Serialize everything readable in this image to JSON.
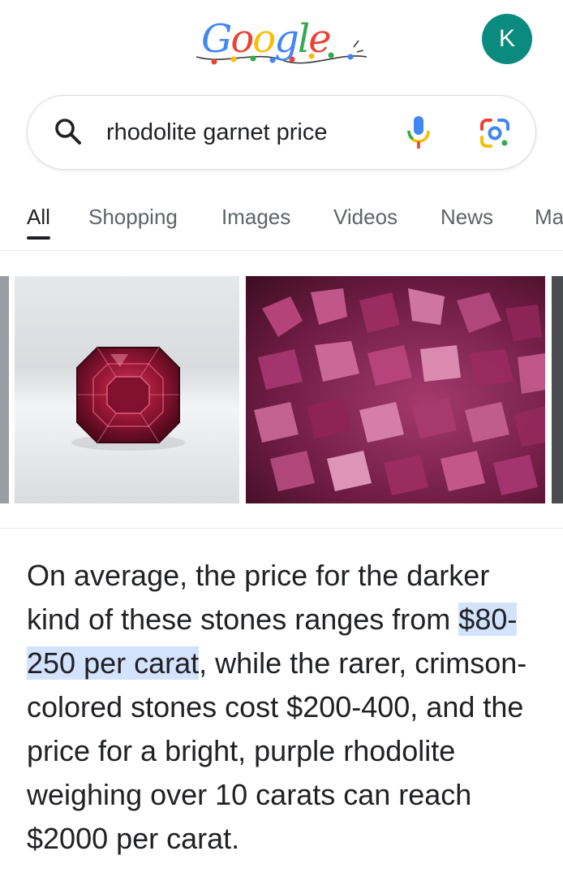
{
  "logo": {
    "text": "Google",
    "letters": [
      "G",
      "o",
      "o",
      "g",
      "l",
      "e"
    ]
  },
  "account": {
    "initial": "K",
    "color": "#0b8a7f"
  },
  "search": {
    "query": "rhodolite garnet price",
    "icons": {
      "search": "search-icon",
      "voice": "microphone-icon",
      "lens": "camera-lens-icon"
    }
  },
  "tabs": [
    {
      "label": "All",
      "active": true
    },
    {
      "label": "Shopping",
      "active": false
    },
    {
      "label": "Images",
      "active": false
    },
    {
      "label": "Videos",
      "active": false
    },
    {
      "label": "News",
      "active": false
    },
    {
      "label": "Ma",
      "active": false
    }
  ],
  "images": [
    {
      "name": "cut-rhodolite-gem-photo"
    },
    {
      "name": "rough-rhodolite-stones-photo"
    }
  ],
  "answer": {
    "before": "On average, the price for the darker kind of these stones ranges from ",
    "highlight": "$80-250 per carat",
    "after": ", while the rarer, crimson-colored stones cost $200-400, and the price for a bright, purple rhodolite weighing over 10 carats can reach $2000 per carat.",
    "highlight_color": "#d3e3fd"
  },
  "colors": {
    "text": "#202124",
    "secondary_text": "#5f6368",
    "border": "#dadce0",
    "google_blue": "#4285f4",
    "google_red": "#ea4335",
    "google_yellow": "#fbbc05",
    "google_green": "#34a853"
  }
}
